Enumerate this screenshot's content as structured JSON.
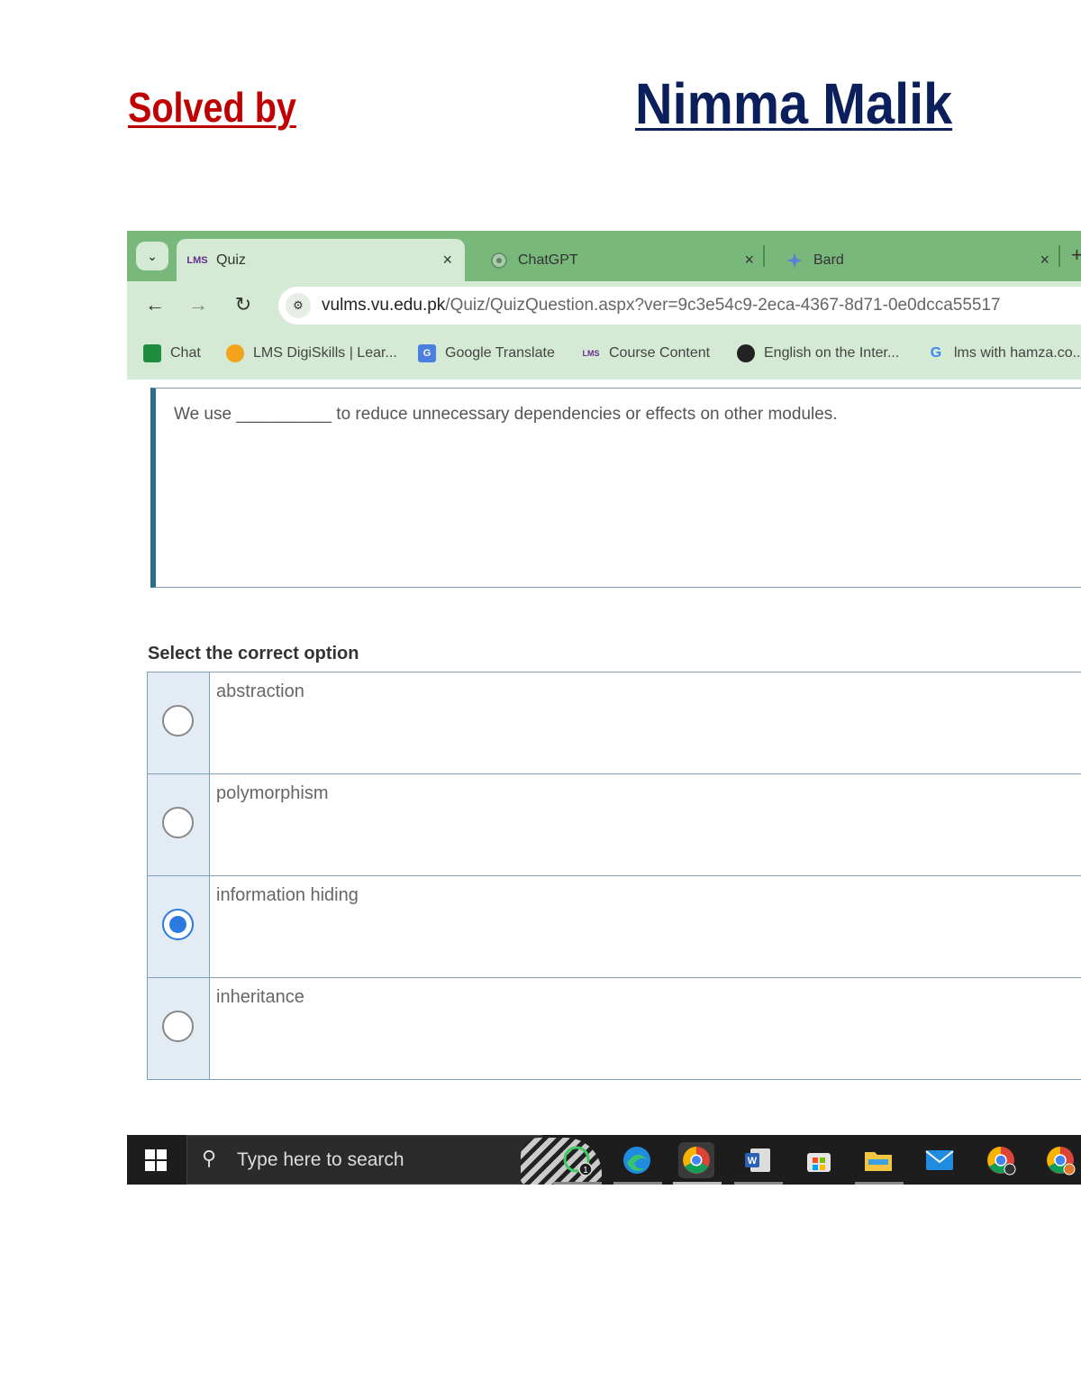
{
  "header": {
    "solved_label": "Solved by",
    "author": "Nimma Malik"
  },
  "browser": {
    "tabs": [
      {
        "label": "Quiz",
        "icon": "lms-icon",
        "active": true
      },
      {
        "label": "ChatGPT",
        "icon": "chatgpt-icon",
        "active": false
      },
      {
        "label": "Bard",
        "icon": "bard-icon",
        "active": false
      }
    ],
    "close_glyph": "×",
    "url_host": "vulms.vu.edu.pk",
    "url_path": "/Quiz/QuizQuestion.aspx?ver=9c3e54c9-2eca-4367-8d71-0e0dcca55517",
    "bookmarks": [
      {
        "label": "Chat",
        "icon": "chat-icon"
      },
      {
        "label": "LMS DigiSkills | Lear...",
        "icon": "digiskills-icon"
      },
      {
        "label": "Google Translate",
        "icon": "translate-icon"
      },
      {
        "label": "Course Content",
        "icon": "lms-icon"
      },
      {
        "label": "English on the Inter...",
        "icon": "globe-icon"
      },
      {
        "label": "lms with hamza.co...",
        "icon": "google-icon"
      }
    ]
  },
  "quiz": {
    "question": "We use __________ to reduce unnecessary dependencies or effects on other modules.",
    "select_label": "Select the correct option",
    "options": [
      {
        "label": "abstraction",
        "selected": false
      },
      {
        "label": "polymorphism",
        "selected": false
      },
      {
        "label": "information hiding",
        "selected": true
      },
      {
        "label": "inheritance",
        "selected": false
      }
    ]
  },
  "taskbar": {
    "search_placeholder": "Type here to search",
    "apps": [
      "whatsapp-icon",
      "edge-icon",
      "chrome-icon",
      "word-icon",
      "store-icon",
      "file-explorer-icon",
      "mail-icon",
      "chrome-profile-icon",
      "chrome-profile-2-icon"
    ],
    "whatsapp_badge": "1"
  },
  "colors": {
    "solved_red": "#c00000",
    "author_navy": "#0a1f5c",
    "tab_green": "#78b87a",
    "toolbar_green": "#d4ead4",
    "radio_blue": "#2b7ae0"
  }
}
